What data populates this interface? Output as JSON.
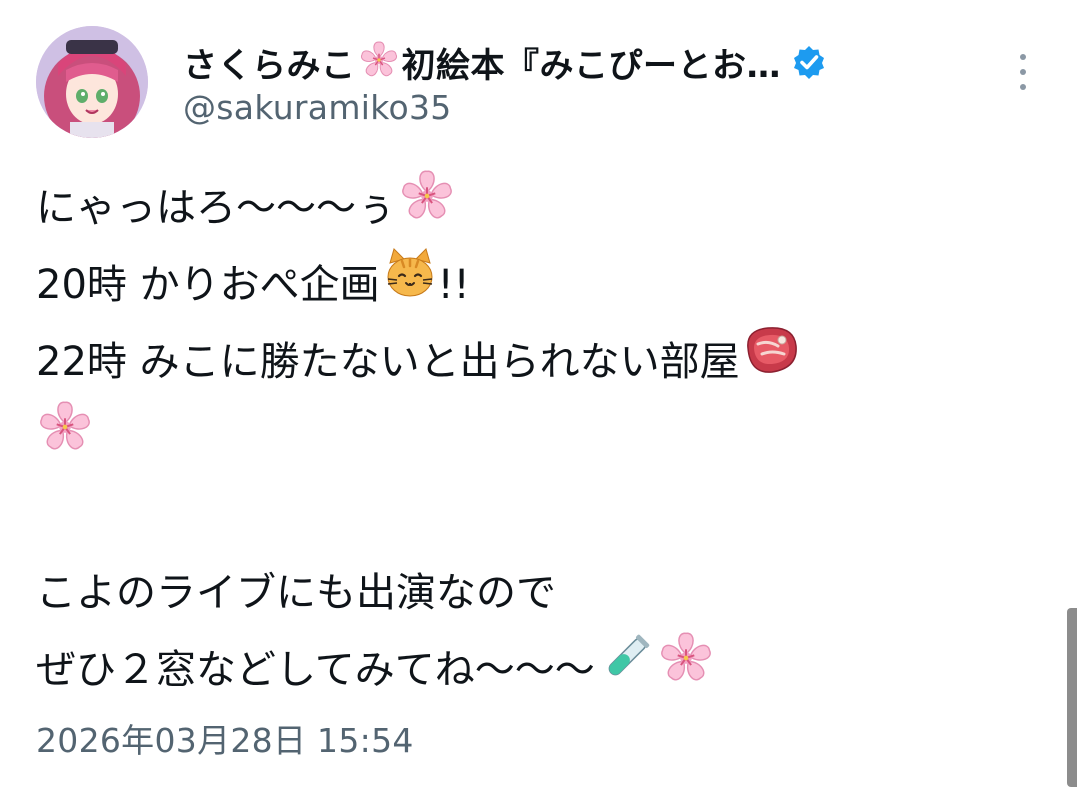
{
  "author": {
    "display_name_part1": "さくらみこ",
    "display_name_part2": "初絵本『みこぴーとお…",
    "handle": "@sakuramiko35",
    "verified": true
  },
  "tweet": {
    "line1": "にゃっはろ〜〜〜ぅ",
    "line2": "20時 かりおぺ企画",
    "line2_suffix": "!!",
    "line3": "22時 みこに勝たないと出られない部屋",
    "line4": "",
    "line5": "",
    "line6": "こよのライブにも出演なので",
    "line7": "ぜひ２窓などしてみてね〜〜〜"
  },
  "timestamp": "2026年03月28日 15:54",
  "icons": {
    "name_emoji": "cherry-blossom-icon",
    "verified": "verified-badge-icon",
    "more": "more-options-icon",
    "line1_emoji": "cherry-blossom-icon",
    "line2_emoji": "cat-face-icon",
    "line3_emoji": "meat-icon",
    "line4_emoji": "cherry-blossom-icon",
    "line7_emoji1": "test-tube-icon",
    "line7_emoji2": "cherry-blossom-icon"
  },
  "colors": {
    "text": "#0f1419",
    "secondary_text": "#536471",
    "verified_blue": "#1d9bf0",
    "blossom_pink": "#f8b5d0"
  }
}
